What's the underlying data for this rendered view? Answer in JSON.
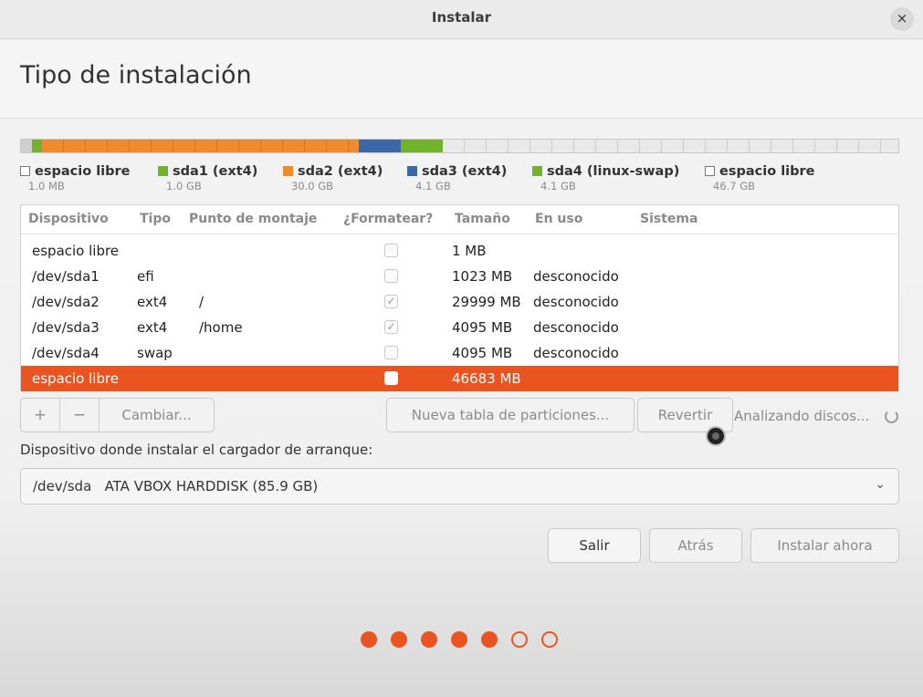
{
  "window": {
    "title": "Instalar",
    "close_glyph": "×"
  },
  "page": {
    "title": "Tipo de instalación"
  },
  "partition_bar": [
    {
      "name": "espacio libre",
      "color": "#cfcfcf",
      "fraction": 0.012
    },
    {
      "name": "sda1 (ext4)",
      "color": "#73b32b",
      "fraction": 0.012
    },
    {
      "name": "sda2 (ext4)",
      "color": "#ef8a2e",
      "fraction": 0.361
    },
    {
      "name": "sda3 (ext4)",
      "color": "#3b68a8",
      "fraction": 0.048
    },
    {
      "name": "sda4 (linux-swap)",
      "color": "#73b32b",
      "fraction": 0.048
    },
    {
      "name": "espacio libre",
      "color": "#e9e9e9",
      "fraction": 0.519
    }
  ],
  "legend": [
    {
      "name": "espacio libre",
      "size": "1.0 MB",
      "color": "#ffffff",
      "border": "#777777"
    },
    {
      "name": "sda1 (ext4)",
      "size": "1.0 GB",
      "color": "#73b32b",
      "border": "#73b32b"
    },
    {
      "name": "sda2 (ext4)",
      "size": "30.0 GB",
      "color": "#ef8a2e",
      "border": "#ef8a2e"
    },
    {
      "name": "sda3 (ext4)",
      "size": "4.1 GB",
      "color": "#3b68a8",
      "border": "#3b68a8"
    },
    {
      "name": "sda4 (linux-swap)",
      "size": "4.1 GB",
      "color": "#73b32b",
      "border": "#73b32b"
    },
    {
      "name": "espacio libre",
      "size": "46.7 GB",
      "color": "#ffffff",
      "border": "#777777"
    }
  ],
  "table": {
    "headers": [
      "Dispositivo",
      "Tipo",
      "Punto de montaje",
      "¿Formatear?",
      "Tamaño",
      "En uso",
      "Sistema"
    ],
    "rows": [
      {
        "device": "espacio libre",
        "type": "",
        "mount": "",
        "format": false,
        "size": "1 MB",
        "used": "",
        "system": "",
        "selected": false
      },
      {
        "device": "/dev/sda1",
        "type": "efi",
        "mount": "",
        "format": false,
        "size": "1023 MB",
        "used": "desconocido",
        "system": "",
        "selected": false
      },
      {
        "device": "/dev/sda2",
        "type": "ext4",
        "mount": "/",
        "format": true,
        "size": "29999 MB",
        "used": "desconocido",
        "system": "",
        "selected": false
      },
      {
        "device": "/dev/sda3",
        "type": "ext4",
        "mount": "/home",
        "format": true,
        "size": "4095 MB",
        "used": "desconocido",
        "system": "",
        "selected": false
      },
      {
        "device": "/dev/sda4",
        "type": "swap",
        "mount": "",
        "format": false,
        "size": "4095 MB",
        "used": "desconocido",
        "system": "",
        "selected": false
      },
      {
        "device": "espacio libre",
        "type": "",
        "mount": "",
        "format": false,
        "size": "46683 MB",
        "used": "",
        "system": "",
        "selected": true
      }
    ]
  },
  "toolbar": {
    "add": "+",
    "remove": "−",
    "change": "Cambiar...",
    "new_table": "Nueva tabla de particiones...",
    "revert": "Revertir",
    "status": "Analizando discos..."
  },
  "bootloader": {
    "label": "Dispositivo donde instalar el cargador de arranque:",
    "value": "/dev/sda   ATA VBOX HARDDISK (85.9 GB)",
    "chevron": "⌄"
  },
  "buttons": {
    "quit": "Salir",
    "back": "Atrás",
    "install": "Instalar ahora"
  },
  "progress": {
    "total_steps": 7,
    "current_step": 5
  },
  "check_glyph": "✓",
  "accent": "#e95420"
}
